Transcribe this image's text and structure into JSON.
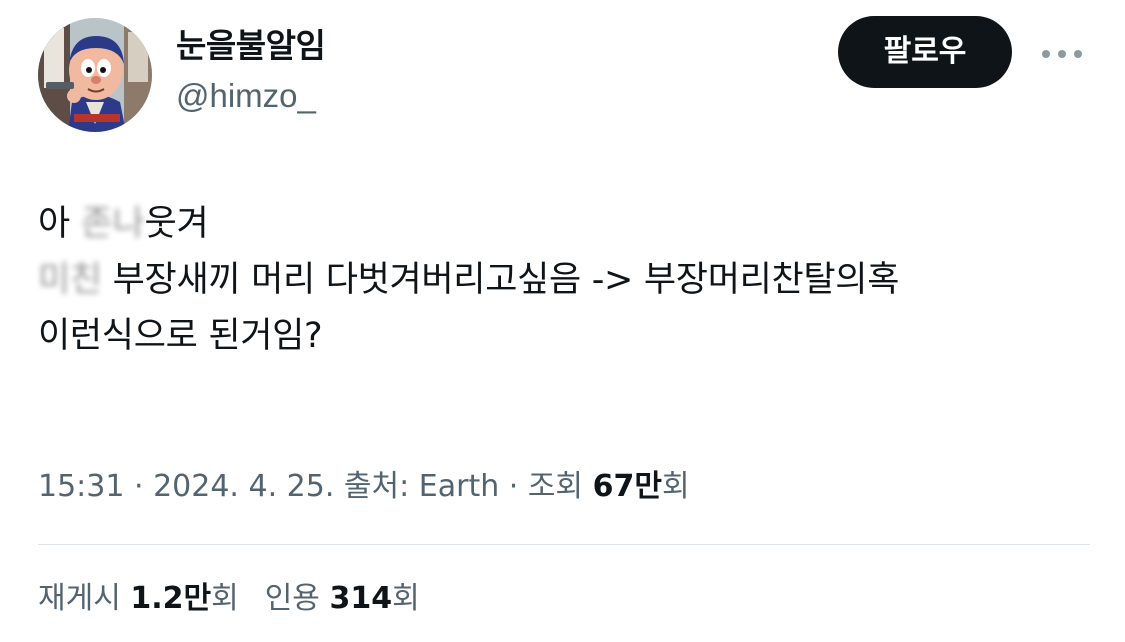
{
  "user": {
    "display_name": "눈을불알임",
    "handle": "@himzo_"
  },
  "header": {
    "follow_label": "팔로우",
    "more_icon": "ellipsis-icon"
  },
  "tweet": {
    "line1_start": "아 ",
    "line1_censored": "존나",
    "line1_end": "웃겨",
    "line2_censored": "미친",
    "line2_end": " 부장새끼 머리 다벗겨버리고싶음 -> 부장머리찬탈의혹",
    "line3": "이런식으로 된거임?"
  },
  "meta": {
    "time": "15:31",
    "sep1": " · ",
    "date": "2024. 4. 25.",
    "source_label": " 출처: ",
    "source": "Earth",
    "sep2": " · ",
    "views_label": "조회 ",
    "views_value": "67만",
    "views_suffix": "회"
  },
  "stats": {
    "retweets_label": "재게시 ",
    "retweets_value": "1.2만",
    "retweets_suffix": "회",
    "quotes_label": "인용 ",
    "quotes_value": "314",
    "quotes_suffix": "회"
  },
  "colors": {
    "text_primary": "#0f1419",
    "text_secondary": "#536471",
    "button_bg": "#0f1419",
    "divider": "#dde3e7"
  }
}
